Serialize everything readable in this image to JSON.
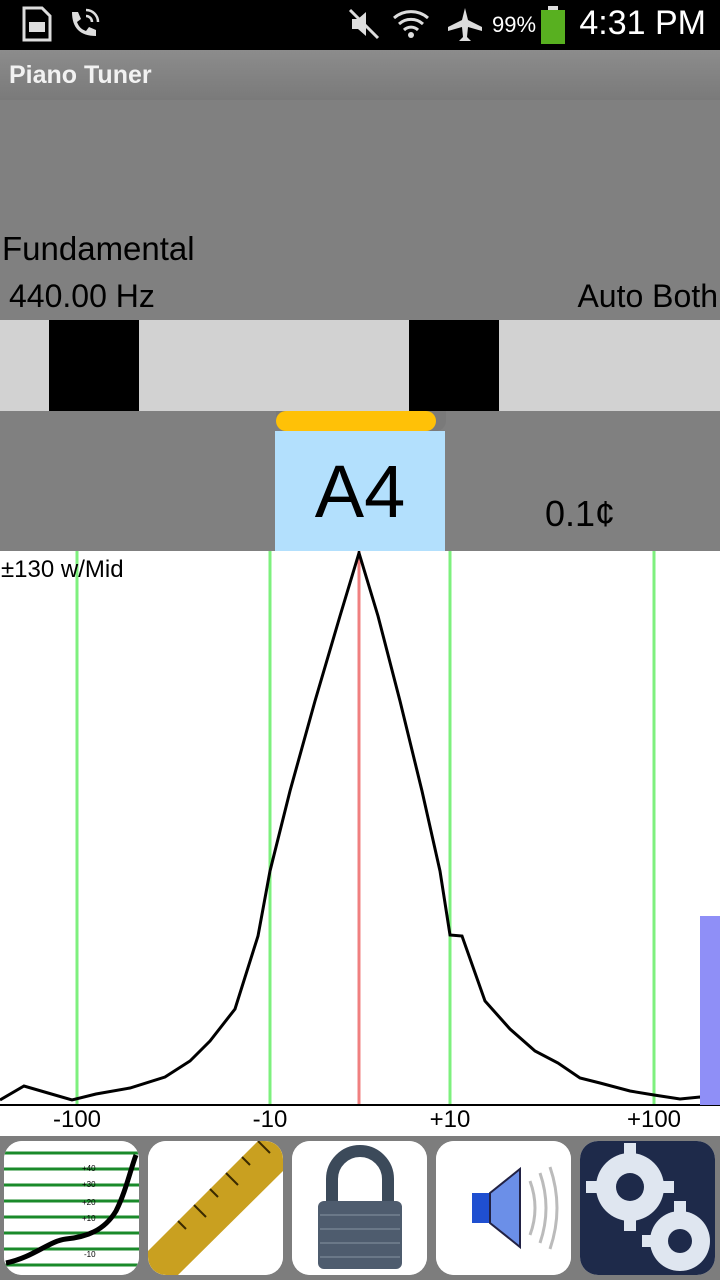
{
  "status": {
    "battery": "99%",
    "time": "4:31 PM"
  },
  "app": {
    "title": "Piano Tuner"
  },
  "info": {
    "mode": "Fundamental",
    "frequency": "440.00 Hz",
    "auto": "Auto Both"
  },
  "note": {
    "name": "A4",
    "cents": "0.1¢",
    "progress": 0.94
  },
  "graph": {
    "range": "±130 w/Mid",
    "ticks": [
      "-100",
      "-10",
      "+10",
      "+100"
    ]
  },
  "colors": {
    "accent": "#ffc107",
    "note_bg": "#b3e0fd",
    "center_line": "#f08080",
    "grid_line": "#7ef07e",
    "level_bar": "#8f8ff7"
  },
  "toolbar": {
    "buttons": [
      "curve-chart-icon",
      "ruler-icon",
      "padlock-icon",
      "speaker-icon",
      "gears-icon"
    ],
    "curve_labels": [
      "+40",
      "+30",
      "+20",
      "+10",
      "-10"
    ]
  }
}
